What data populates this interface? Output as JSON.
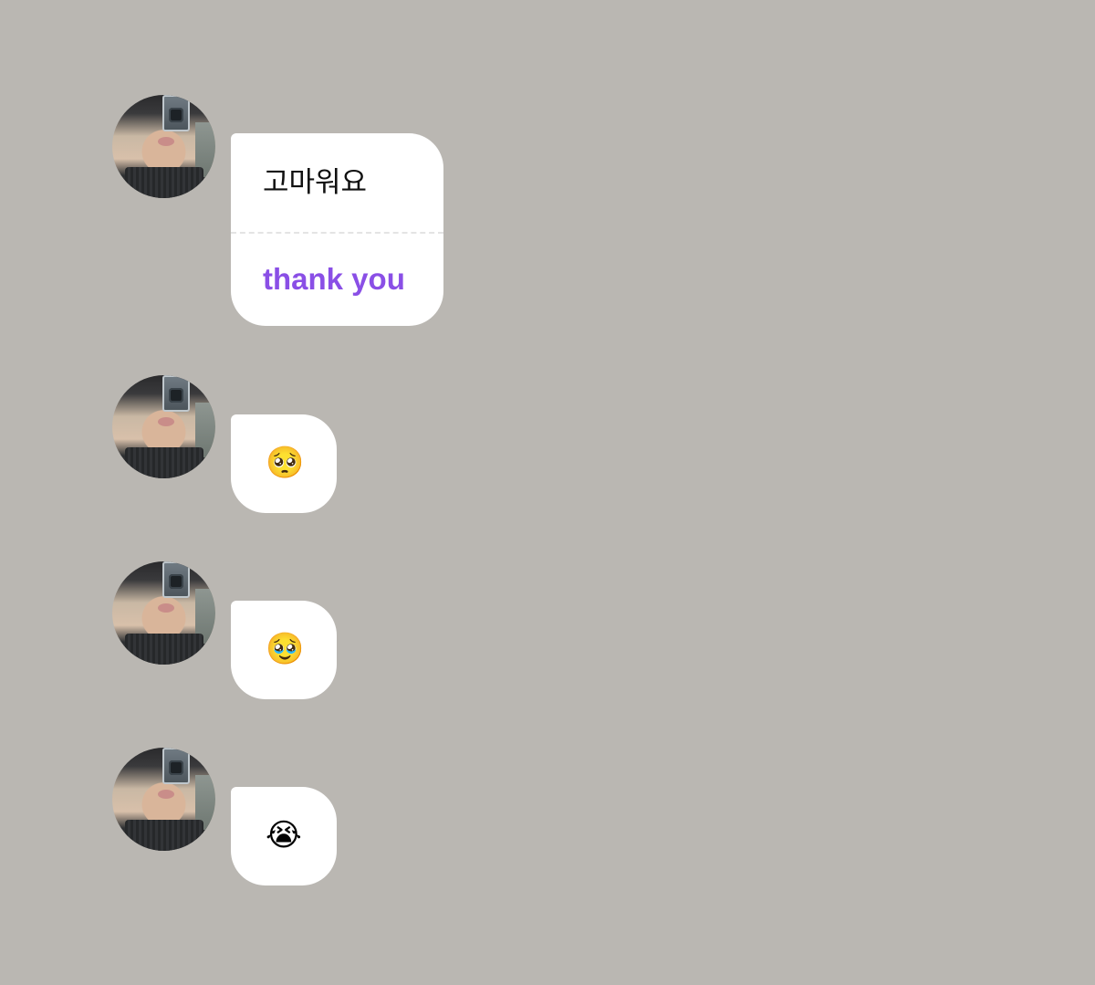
{
  "messages": [
    {
      "original": "고마워요",
      "translation": "thank you"
    },
    {
      "emoji": "🥺",
      "emoji_name": "pleading-face"
    },
    {
      "emoji": "🥹",
      "emoji_name": "face-holding-back-tears"
    },
    {
      "emoji": "😭",
      "emoji_name": "loudly-crying-face"
    }
  ],
  "colors": {
    "background": "#bab7b2",
    "bubble": "#ffffff",
    "translation_text": "#8a4fe6"
  }
}
